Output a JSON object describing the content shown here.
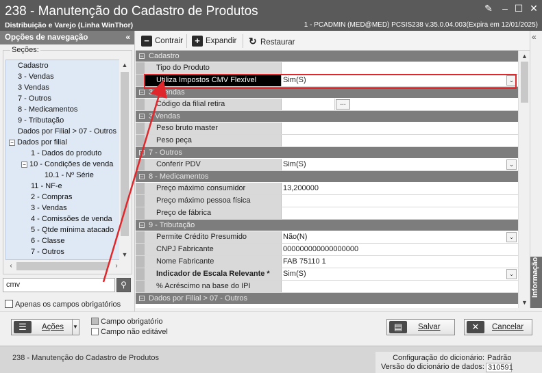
{
  "window": {
    "title": "238 - Manutenção do Cadastro de Produtos",
    "subtitle": "Distribuição e Varejo (Linha WinThor)",
    "info": "1 - PCADMIN (MED@MED)   PCSIS238  v.35.0.04.003(Expira em 12/01/2025)"
  },
  "nav": {
    "header": "Opções de navegação",
    "sections_label": "Seções:",
    "tree": [
      {
        "label": "Cadastro",
        "indent": 0,
        "expander": ""
      },
      {
        "label": "3 - Vendas",
        "indent": 0,
        "expander": ""
      },
      {
        "label": "3 Vendas",
        "indent": 0,
        "expander": ""
      },
      {
        "label": "7 - Outros",
        "indent": 0,
        "expander": ""
      },
      {
        "label": "8 - Medicamentos",
        "indent": 0,
        "expander": ""
      },
      {
        "label": "9 - Tributação",
        "indent": 0,
        "expander": ""
      },
      {
        "label": "Dados por Filial > 07 - Outros",
        "indent": 0,
        "expander": ""
      },
      {
        "label": "Dados por filial",
        "indent": 0,
        "expander": "−"
      },
      {
        "label": "1 - Dados do produto",
        "indent": 1,
        "expander": ""
      },
      {
        "label": "10 - Condições de venda",
        "indent": 1,
        "expander": "−"
      },
      {
        "label": "10.1 - Nº Série",
        "indent": 2,
        "expander": ""
      },
      {
        "label": "11 - NF-e",
        "indent": 1,
        "expander": ""
      },
      {
        "label": "2 - Compras",
        "indent": 1,
        "expander": ""
      },
      {
        "label": "3 - Vendas",
        "indent": 1,
        "expander": ""
      },
      {
        "label": "4 - Comissões de venda",
        "indent": 1,
        "expander": ""
      },
      {
        "label": "5 - Qtde mínima atacado",
        "indent": 1,
        "expander": ""
      },
      {
        "label": "6 - Classe",
        "indent": 1,
        "expander": ""
      },
      {
        "label": "7 - Outros",
        "indent": 1,
        "expander": ""
      }
    ],
    "search_value": "cmv",
    "only_required_label": "Apenas os campos obrigatórios"
  },
  "toolbar": {
    "collapse_label": "Contrair",
    "expand_label": "Expandir",
    "restore_label": "Restaurar"
  },
  "grid": [
    {
      "type": "cat",
      "label": "Cadastro"
    },
    {
      "type": "row",
      "label": "Tipo do Produto",
      "value": ""
    },
    {
      "type": "row",
      "label": "Utiliza Impostos CMV Flexível",
      "value": "Sim(S)",
      "dropdown": true,
      "selected": true
    },
    {
      "type": "cat",
      "label": "3 - Vendas"
    },
    {
      "type": "row",
      "label": "Código da filial retira",
      "value": "",
      "ellipsis": true
    },
    {
      "type": "cat",
      "label": "3 Vendas"
    },
    {
      "type": "row",
      "label": "Peso bruto master",
      "value": ""
    },
    {
      "type": "row",
      "label": "Peso peça",
      "value": ""
    },
    {
      "type": "cat",
      "label": "7 - Outros"
    },
    {
      "type": "row",
      "label": "Conferir PDV",
      "value": "Sim(S)",
      "dropdown": true
    },
    {
      "type": "cat",
      "label": "8 - Medicamentos"
    },
    {
      "type": "row",
      "label": "Preço máximo consumidor",
      "value": "13,200000"
    },
    {
      "type": "row",
      "label": "Preço máximo pessoa física",
      "value": ""
    },
    {
      "type": "row",
      "label": "Preço de fábrica",
      "value": ""
    },
    {
      "type": "cat",
      "label": "9 - Tributação"
    },
    {
      "type": "row",
      "label": "Permite Crédito Presumido",
      "value": "Não(N)",
      "dropdown": true
    },
    {
      "type": "row",
      "label": "CNPJ Fabricante",
      "value": "000000000000000000"
    },
    {
      "type": "row",
      "label": "Nome Fabricante",
      "value": "FAB 75110 1"
    },
    {
      "type": "row",
      "label": "Indicador de Escala Relevante *",
      "value": "Sim(S)",
      "dropdown": true,
      "bold": true
    },
    {
      "type": "row",
      "label": "% Acréscimo na base do IPI",
      "value": ""
    },
    {
      "type": "cat",
      "label": "Dados por Filial > 07 - Outros"
    }
  ],
  "side_tab": {
    "label": "Informação"
  },
  "actions": {
    "actions_label": "Ações",
    "legend_required": "Campo obrigatório",
    "legend_readonly": "Campo não editável",
    "save_label": "Salvar",
    "cancel_label": "Cancelar"
  },
  "status": {
    "left": "238 - Manutenção do Cadastro de Produtos",
    "dict_config_label": "Configuração do dicionário:",
    "dict_config_value": "Padrão",
    "dict_version_label": "Versão do dicionário de dados:",
    "dict_version_value": "310591"
  },
  "colors": {
    "titlebar": "#5a5a5a",
    "highlight_border": "#e0282c",
    "category_band": "#7d7d7d"
  }
}
